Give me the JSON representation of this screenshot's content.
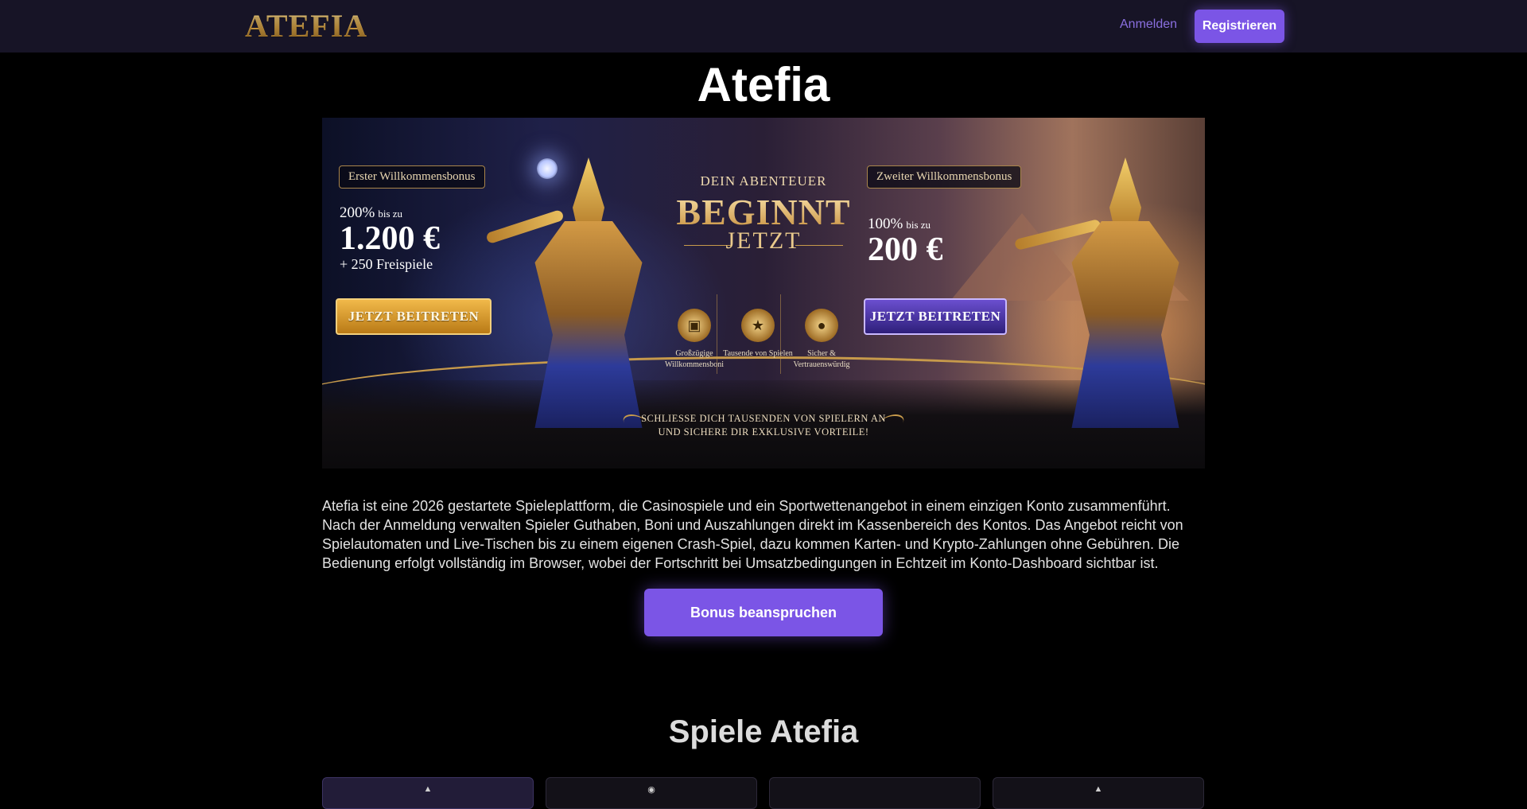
{
  "header": {
    "logo_text": "ATEFIA",
    "login_label": "Anmelden",
    "register_label": "Registrieren"
  },
  "page_title": "Atefia",
  "banner": {
    "first_bonus": {
      "tag": "Erster Willkommensbonus",
      "percent": "200%",
      "bis_zu": "bis zu",
      "amount": "1.200 €",
      "extra": "+ 250 Freispiele",
      "button": "JETZT BEITRETEN"
    },
    "center": {
      "line1": "DEIN ABENTEUER",
      "line2": "BEGINNT",
      "line3": "JETZT"
    },
    "features": [
      {
        "icon": "treasure-chest-icon",
        "label": "Großzügige Willkommensboni"
      },
      {
        "icon": "trophy-icon",
        "label": "Tausende von Spielen"
      },
      {
        "icon": "padlock-icon",
        "label": "Sicher & Vertrauenswürdig"
      }
    ],
    "second_bonus": {
      "tag": "Zweiter Willkommensbonus",
      "percent": "100%",
      "bis_zu": "bis zu",
      "amount": "200 €",
      "button": "JETZT BEITRETEN"
    },
    "footer_line1": "SCHLIESSE DICH TAUSENDEN VON SPIELERN AN",
    "footer_line2": "UND SICHERE DIR EXKLUSIVE VORTEILE!"
  },
  "intro_text": "Atefia ist eine 2026 gestartete Spieleplattform, die Casinospiele und ein Sportwettenangebot in einem einzigen Konto zusammenführt. Nach der Anmeldung verwalten Spieler Guthaben, Boni und Auszahlungen direkt im Kassenbereich des Kontos. Das Angebot reicht von Spielautomaten und Live-Tischen bis zu einem eigenen Crash-Spiel, dazu kommen Karten- und Krypto-Zahlungen ohne Gebühren. Die Bedienung erfolgt vollständig im Browser, wobei der Fortschritt bei Umsatzbedingungen in Echtzeit im Konto-Dashboard sichtbar ist.",
  "cta_label": "Bonus beanspruchen",
  "games_title": "Spiele Atefia",
  "game_cards": [
    {
      "icon": "game-icon-1"
    },
    {
      "icon": "live-icon"
    },
    {
      "icon": "game-icon-3"
    },
    {
      "icon": "game-icon-4"
    }
  ],
  "colors": {
    "header_bg": "#171426",
    "accent": "#7b55e6",
    "login_link": "#8a6fe0",
    "page_bg": "#000000",
    "gold": "#c79a4b"
  }
}
